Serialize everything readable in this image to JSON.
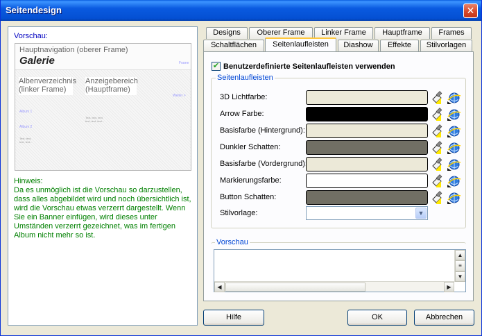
{
  "window": {
    "title": "Seitendesign",
    "close_glyph": "✕"
  },
  "left": {
    "preview_label": "Vorschau:",
    "preview": {
      "top_nav": "Hauptnavigation (oberer Frame)",
      "gallery_title": "Galerie",
      "frames_link": "Frame",
      "album_dir": "Albenverzeichnis\n(linker Frame)",
      "display_area": "Anzeigebereich\n(Hauptframe)",
      "next_link": "Weiter >",
      "album1": "Album 1",
      "album2": "Album 2",
      "left_small": "Text, text,\ntext, text...",
      "main_small": "Text, text, text,\ntext, text, text..."
    },
    "hint": "Hinweis:\nDa es unmöglich ist die Vorschau so darzustellen, dass alles abgebildet wird und noch übersichtlich ist, wird die Vorschau etwas verzerrt dargestellt. Wenn Sie ein Banner einfügen, wird dieses unter Umständen verzerrt gezeichnet, was im fertigen Album nicht mehr so ist."
  },
  "tabs": {
    "row1": [
      "Designs",
      "Oberer Frame",
      "Linker Frame",
      "Hauptframe",
      "Frames"
    ],
    "row2": [
      "Schaltflächen",
      "Seitenlaufleisten",
      "Diashow",
      "Effekte",
      "Stilvorlagen"
    ],
    "active": "Seitenlaufleisten"
  },
  "panel": {
    "use_custom_label": "Benutzerdefinierte Seitenlaufleisten verwenden",
    "use_custom_checked": true,
    "group_title": "Seitenlaufleisten",
    "rows": [
      {
        "label": "3D Lichtfarbe:",
        "color": "#ece9d8"
      },
      {
        "label": "Arrow Farbe:",
        "color": "#000000"
      },
      {
        "label": "Basisfarbe (Hintergrund):",
        "color": "#ece9d8"
      },
      {
        "label": "Dunkler Schatten:",
        "color": "#716f64"
      },
      {
        "label": "Basisfarbe (Vordergrund):",
        "color": "#ece9d8"
      },
      {
        "label": "Markierungsfarbe:",
        "color": "#ffffff"
      },
      {
        "label": "Button Schatten:",
        "color": "#716f64"
      }
    ],
    "style_label": "Stilvorlage:",
    "style_value": "",
    "preview_group_title": "Vorschau"
  },
  "buttons": {
    "help": "Hilfe",
    "ok": "OK",
    "cancel": "Abbrechen"
  },
  "colors": {
    "accent_blue": "#0046d5",
    "hint_green": "#008000",
    "tab_highlight": "#ffc83c"
  }
}
